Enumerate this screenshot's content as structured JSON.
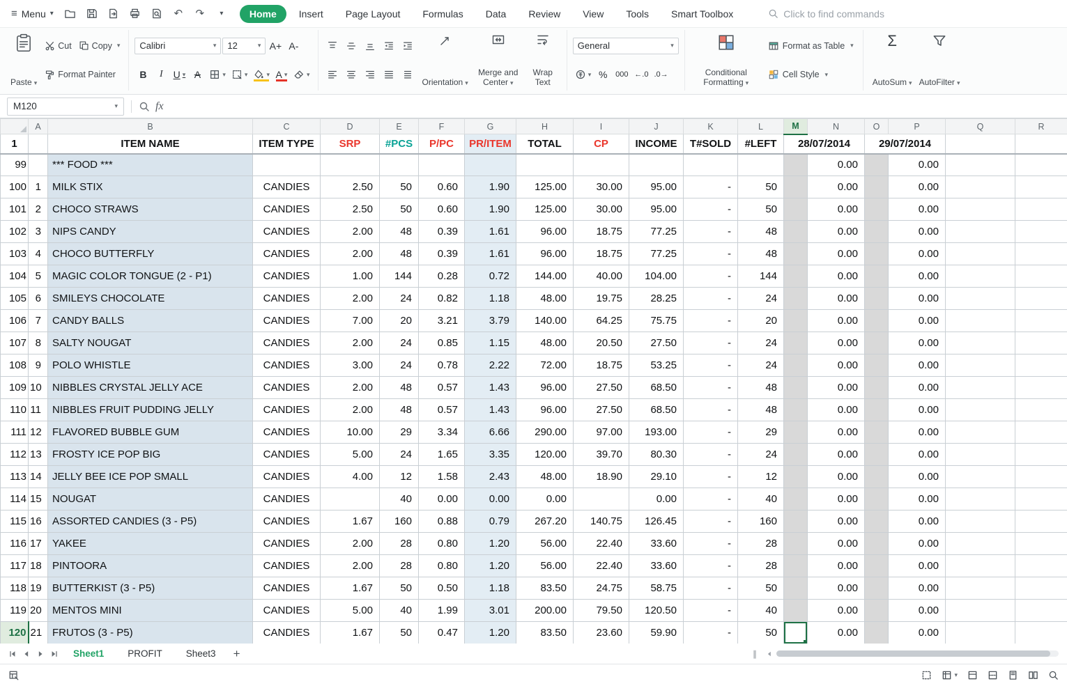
{
  "colors": {
    "accent_green": "#21a366",
    "selection_green": "#1e7145",
    "header_red": "#ea362c",
    "header_teal": "#0aa396",
    "col_b_bg": "#d9e4ed",
    "col_g_bg": "#e3edf4",
    "gray_col_bg": "#d9d9d9"
  },
  "glyphs": {
    "hamburger": "≡",
    "chevron": "▾",
    "undo": "↶",
    "redo": "↷",
    "split": "∥"
  },
  "menubar": {
    "menu_label": "Menu",
    "tabs": [
      {
        "label": "Home",
        "active": true
      },
      {
        "label": "Insert"
      },
      {
        "label": "Page Layout"
      },
      {
        "label": "Formulas"
      },
      {
        "label": "Data"
      },
      {
        "label": "Review"
      },
      {
        "label": "View"
      },
      {
        "label": "Tools"
      },
      {
        "label": "Smart Toolbox"
      }
    ],
    "search_placeholder": "Click to find commands"
  },
  "ribbon": {
    "paste_label": "Paste",
    "cut_label": "Cut",
    "copy_label": "Copy",
    "format_painter_label": "Format Painter",
    "font_name": "Calibri",
    "font_size": "12",
    "grow_font_glyph": "A+",
    "shrink_font_glyph": "A-",
    "bold_glyph": "B",
    "italic_glyph": "I",
    "underline_glyph": "U",
    "strike_glyph": "A",
    "font_color_glyph": "A",
    "orientation_label": "Orientation",
    "merge_center_label": "Merge and Center",
    "wrap_text_label": "Wrap Text",
    "number_format_value": "General",
    "percent_glyph": "%",
    "thousands_glyph": "000",
    "inc_decimal_glyph": "←.0",
    "dec_decimal_glyph": ".0→",
    "conditional_formatting_label": "Conditional Formatting",
    "format_as_table_label": "Format as Table",
    "cell_style_label": "Cell Style",
    "autosum_glyph": "Σ",
    "autosum_label": "AutoSum",
    "autofilter_label": "AutoFilter"
  },
  "formula_bar": {
    "name_box_value": "M120",
    "fx_label": "fx",
    "formula_value": ""
  },
  "grid": {
    "column_letters": [
      "A",
      "B",
      "C",
      "D",
      "E",
      "F",
      "G",
      "H",
      "I",
      "J",
      "K",
      "L",
      "M",
      "N",
      "O",
      "P",
      "Q",
      "R"
    ],
    "selected_cell": "M120",
    "selected_column": "M",
    "selected_row_num": "120",
    "header_row": {
      "row_num": "1",
      "item_name": "ITEM NAME",
      "item_type": "ITEM TYPE",
      "srp": "SRP",
      "pcs": "#PCS",
      "ppc": "P/PC",
      "pr_item": "PR/ITEM",
      "total": "TOTAL",
      "cp": "CP",
      "income": "INCOME",
      "t_sold": "T#SOLD",
      "left": "#LEFT",
      "date1": "28/07/2014",
      "date2": "29/07/2014"
    },
    "rows": [
      {
        "num": "99",
        "a": "",
        "name": "*** FOOD ***",
        "type": "",
        "srp": "",
        "pcs": "",
        "ppc": "",
        "pritem": "",
        "total": "",
        "cp": "",
        "income": "",
        "tsold": "",
        "left": "",
        "n": "0.00",
        "p": "0.00"
      },
      {
        "num": "100",
        "a": "1",
        "name": "MILK STIX",
        "type": "CANDIES",
        "srp": "2.50",
        "pcs": "50",
        "ppc": "0.60",
        "pritem": "1.90",
        "total": "125.00",
        "cp": "30.00",
        "income": "95.00",
        "tsold": "-",
        "left": "50",
        "n": "0.00",
        "p": "0.00"
      },
      {
        "num": "101",
        "a": "2",
        "name": "CHOCO STRAWS",
        "type": "CANDIES",
        "srp": "2.50",
        "pcs": "50",
        "ppc": "0.60",
        "pritem": "1.90",
        "total": "125.00",
        "cp": "30.00",
        "income": "95.00",
        "tsold": "-",
        "left": "50",
        "n": "0.00",
        "p": "0.00"
      },
      {
        "num": "102",
        "a": "3",
        "name": "NIPS CANDY",
        "type": "CANDIES",
        "srp": "2.00",
        "pcs": "48",
        "ppc": "0.39",
        "pritem": "1.61",
        "total": "96.00",
        "cp": "18.75",
        "income": "77.25",
        "tsold": "-",
        "left": "48",
        "n": "0.00",
        "p": "0.00"
      },
      {
        "num": "103",
        "a": "4",
        "name": "CHOCO BUTTERFLY",
        "type": "CANDIES",
        "srp": "2.00",
        "pcs": "48",
        "ppc": "0.39",
        "pritem": "1.61",
        "total": "96.00",
        "cp": "18.75",
        "income": "77.25",
        "tsold": "-",
        "left": "48",
        "n": "0.00",
        "p": "0.00"
      },
      {
        "num": "104",
        "a": "5",
        "name": "MAGIC COLOR TONGUE (2 - P1)",
        "type": "CANDIES",
        "srp": "1.00",
        "pcs": "144",
        "ppc": "0.28",
        "pritem": "0.72",
        "total": "144.00",
        "cp": "40.00",
        "income": "104.00",
        "tsold": "-",
        "left": "144",
        "n": "0.00",
        "p": "0.00"
      },
      {
        "num": "105",
        "a": "6",
        "name": "SMILEYS CHOCOLATE",
        "type": "CANDIES",
        "srp": "2.00",
        "pcs": "24",
        "ppc": "0.82",
        "pritem": "1.18",
        "total": "48.00",
        "cp": "19.75",
        "income": "28.25",
        "tsold": "-",
        "left": "24",
        "n": "0.00",
        "p": "0.00"
      },
      {
        "num": "106",
        "a": "7",
        "name": "CANDY BALLS",
        "type": "CANDIES",
        "srp": "7.00",
        "pcs": "20",
        "ppc": "3.21",
        "pritem": "3.79",
        "total": "140.00",
        "cp": "64.25",
        "income": "75.75",
        "tsold": "-",
        "left": "20",
        "n": "0.00",
        "p": "0.00"
      },
      {
        "num": "107",
        "a": "8",
        "name": "SALTY NOUGAT",
        "type": "CANDIES",
        "srp": "2.00",
        "pcs": "24",
        "ppc": "0.85",
        "pritem": "1.15",
        "total": "48.00",
        "cp": "20.50",
        "income": "27.50",
        "tsold": "-",
        "left": "24",
        "n": "0.00",
        "p": "0.00"
      },
      {
        "num": "108",
        "a": "9",
        "name": "POLO WHISTLE",
        "type": "CANDIES",
        "srp": "3.00",
        "pcs": "24",
        "ppc": "0.78",
        "pritem": "2.22",
        "total": "72.00",
        "cp": "18.75",
        "income": "53.25",
        "tsold": "-",
        "left": "24",
        "n": "0.00",
        "p": "0.00"
      },
      {
        "num": "109",
        "a": "10",
        "name": "NIBBLES CRYSTAL JELLY ACE",
        "type": "CANDIES",
        "srp": "2.00",
        "pcs": "48",
        "ppc": "0.57",
        "pritem": "1.43",
        "total": "96.00",
        "cp": "27.50",
        "income": "68.50",
        "tsold": "-",
        "left": "48",
        "n": "0.00",
        "p": "0.00"
      },
      {
        "num": "110",
        "a": "11",
        "name": "NIBBLES FRUIT PUDDING JELLY",
        "type": "CANDIES",
        "srp": "2.00",
        "pcs": "48",
        "ppc": "0.57",
        "pritem": "1.43",
        "total": "96.00",
        "cp": "27.50",
        "income": "68.50",
        "tsold": "-",
        "left": "48",
        "n": "0.00",
        "p": "0.00"
      },
      {
        "num": "111",
        "a": "12",
        "name": "FLAVORED BUBBLE GUM",
        "type": "CANDIES",
        "srp": "10.00",
        "pcs": "29",
        "ppc": "3.34",
        "pritem": "6.66",
        "total": "290.00",
        "cp": "97.00",
        "income": "193.00",
        "tsold": "-",
        "left": "29",
        "n": "0.00",
        "p": "0.00"
      },
      {
        "num": "112",
        "a": "13",
        "name": "FROSTY ICE POP BIG",
        "type": "CANDIES",
        "srp": "5.00",
        "pcs": "24",
        "ppc": "1.65",
        "pritem": "3.35",
        "total": "120.00",
        "cp": "39.70",
        "income": "80.30",
        "tsold": "-",
        "left": "24",
        "n": "0.00",
        "p": "0.00"
      },
      {
        "num": "113",
        "a": "14",
        "name": "JELLY BEE ICE POP SMALL",
        "type": "CANDIES",
        "srp": "4.00",
        "pcs": "12",
        "ppc": "1.58",
        "pritem": "2.43",
        "total": "48.00",
        "cp": "18.90",
        "income": "29.10",
        "tsold": "-",
        "left": "12",
        "n": "0.00",
        "p": "0.00"
      },
      {
        "num": "114",
        "a": "15",
        "name": "NOUGAT",
        "type": "CANDIES",
        "srp": "",
        "pcs": "40",
        "ppc": "0.00",
        "pritem": "0.00",
        "total": "0.00",
        "cp": "",
        "income": "0.00",
        "tsold": "-",
        "left": "40",
        "n": "0.00",
        "p": "0.00"
      },
      {
        "num": "115",
        "a": "16",
        "name": "ASSORTED CANDIES (3 - P5)",
        "type": "CANDIES",
        "srp": "1.67",
        "pcs": "160",
        "ppc": "0.88",
        "pritem": "0.79",
        "total": "267.20",
        "cp": "140.75",
        "income": "126.45",
        "tsold": "-",
        "left": "160",
        "n": "0.00",
        "p": "0.00"
      },
      {
        "num": "116",
        "a": "17",
        "name": "YAKEE",
        "type": "CANDIES",
        "srp": "2.00",
        "pcs": "28",
        "ppc": "0.80",
        "pritem": "1.20",
        "total": "56.00",
        "cp": "22.40",
        "income": "33.60",
        "tsold": "-",
        "left": "28",
        "n": "0.00",
        "p": "0.00"
      },
      {
        "num": "117",
        "a": "18",
        "name": "PINTOORA",
        "type": "CANDIES",
        "srp": "2.00",
        "pcs": "28",
        "ppc": "0.80",
        "pritem": "1.20",
        "total": "56.00",
        "cp": "22.40",
        "income": "33.60",
        "tsold": "-",
        "left": "28",
        "n": "0.00",
        "p": "0.00"
      },
      {
        "num": "118",
        "a": "19",
        "name": "BUTTERKIST (3 - P5)",
        "type": "CANDIES",
        "srp": "1.67",
        "pcs": "50",
        "ppc": "0.50",
        "pritem": "1.18",
        "total": "83.50",
        "cp": "24.75",
        "income": "58.75",
        "tsold": "-",
        "left": "50",
        "n": "0.00",
        "p": "0.00"
      },
      {
        "num": "119",
        "a": "20",
        "name": "MENTOS MINI",
        "type": "CANDIES",
        "srp": "5.00",
        "pcs": "40",
        "ppc": "1.99",
        "pritem": "3.01",
        "total": "200.00",
        "cp": "79.50",
        "income": "120.50",
        "tsold": "-",
        "left": "40",
        "n": "0.00",
        "p": "0.00"
      },
      {
        "num": "120",
        "a": "21",
        "name": "FRUTOS (3 - P5)",
        "type": "CANDIES",
        "srp": "1.67",
        "pcs": "50",
        "ppc": "0.47",
        "pritem": "1.20",
        "total": "83.50",
        "cp": "23.60",
        "income": "59.90",
        "tsold": "-",
        "left": "50",
        "n": "0.00",
        "p": "0.00"
      }
    ]
  },
  "sheet_bar": {
    "tabs": [
      {
        "label": "Sheet1",
        "active": true
      },
      {
        "label": "PROFIT"
      },
      {
        "label": "Sheet3"
      }
    ],
    "add_glyph": "+"
  }
}
